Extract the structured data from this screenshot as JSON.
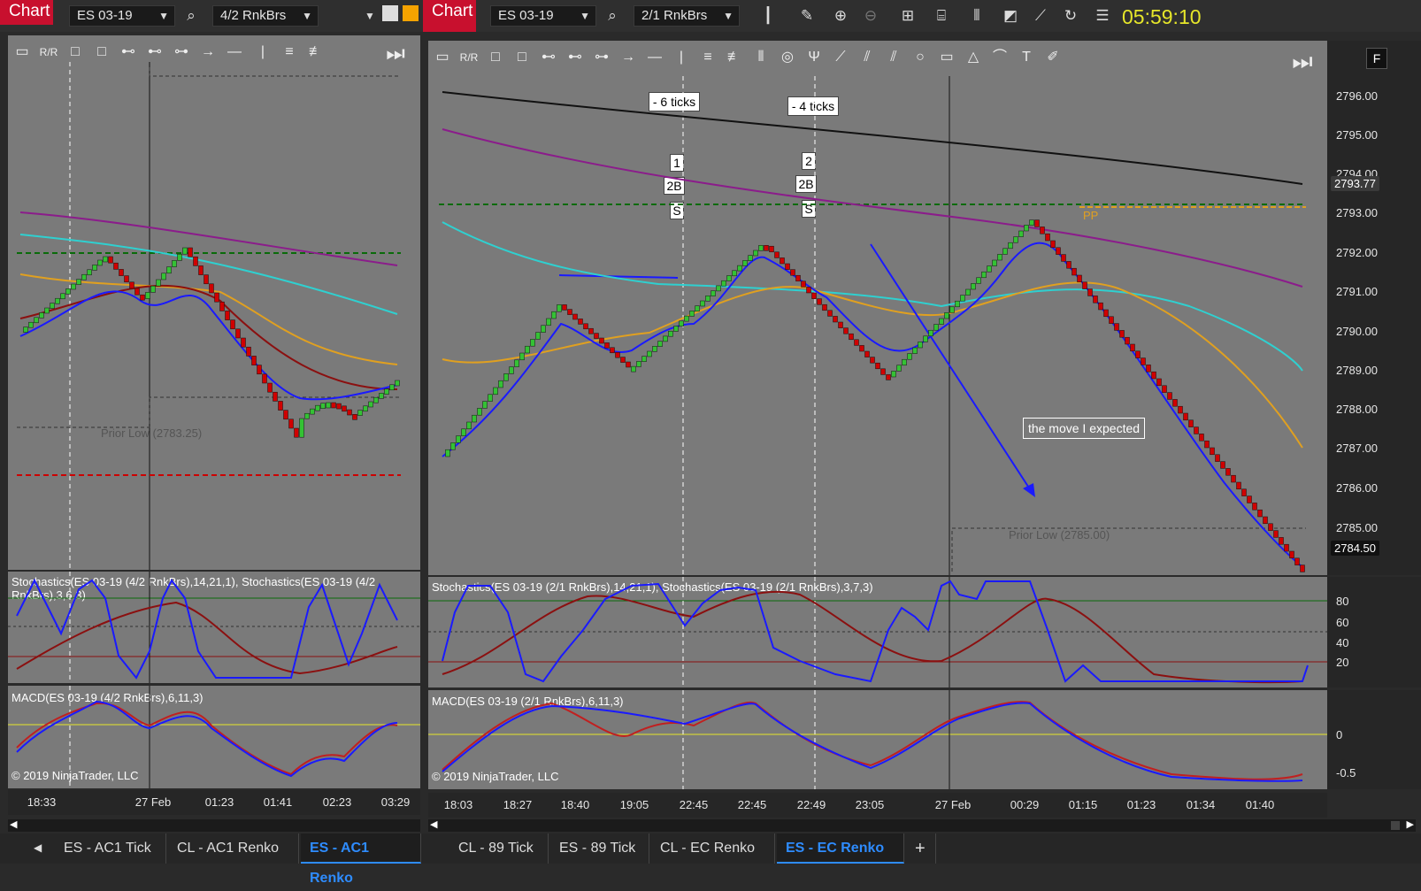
{
  "left": {
    "chart_button": "Chart",
    "instrument": "ES 03-19",
    "bartype": "4/2 RnkBrs",
    "stoch_title": "Stochastics(ES 03-19 (4/2 RnkBrs),14,21,1), Stochastics(ES 03-19 (4/2 RnkBrs),3,6,3)",
    "macd_title": "MACD(ES 03-19 (4/2 RnkBrs),6,11,3)",
    "copyright": "© 2019 NinjaTrader, LLC",
    "prior_low": "Prior Low (2783.25)",
    "x_labels": [
      "18:33",
      "27 Feb",
      "01:23",
      "01:41",
      "02:23",
      "03:29"
    ],
    "tabs": [
      "ES - AC1 Tick",
      "CL - AC1 Renko",
      "ES - AC1 Renko"
    ],
    "active_tab": 2
  },
  "right": {
    "chart_button": "Chart",
    "instrument": "ES 03-19",
    "bartype": "2/1 RnkBrs",
    "clock": "05:59:10",
    "f_button": "F",
    "stoch_title": "Stochastics(ES 03-19 (2/1 RnkBrs),14,21,1), Stochastics(ES 03-19 (2/1 RnkBrs),3,7,3)",
    "macd_title": "MACD(ES 03-19 (2/1 RnkBrs),6,11,3)",
    "copyright": "© 2019 NinjaTrader, LLC",
    "prior_low": "Prior Low (2785.00)",
    "annotation_move": "the move I expected",
    "pp_label": "PP",
    "ticks1": "- 6 ticks",
    "ticks2": "- 4 ticks",
    "marker1": [
      "1",
      "2B",
      "S"
    ],
    "marker2": [
      "2",
      "2B",
      "S"
    ],
    "price_labels": [
      "2796.00",
      "2795.00",
      "2794.00",
      "2793.00",
      "2792.00",
      "2791.00",
      "2790.00",
      "2789.00",
      "2788.00",
      "2787.00",
      "2786.00",
      "2785.00"
    ],
    "price_tag_last": "2793.77",
    "price_tag_current": "2784.50",
    "stoch_levels": [
      "80",
      "60",
      "40",
      "20"
    ],
    "macd_levels": [
      "0",
      "-0.5"
    ],
    "x_labels": [
      "18:03",
      "18:27",
      "18:40",
      "19:05",
      "22:45",
      "22:45",
      "22:49",
      "23:05",
      "27 Feb",
      "00:29",
      "01:15",
      "01:23",
      "01:34",
      "01:40"
    ],
    "tabs": [
      "CL - 89 Tick",
      "ES - 89 Tick",
      "CL - EC Renko",
      "ES - EC Renko"
    ],
    "active_tab": 3,
    "add_tab": "+"
  },
  "colors": {
    "chart_bg": "#7a7a7a",
    "up_bar": "#34c234",
    "down_bar": "#d00000",
    "accent": "#c8102e",
    "clock": "#e6e62a",
    "tab_active": "#2e8cff"
  }
}
